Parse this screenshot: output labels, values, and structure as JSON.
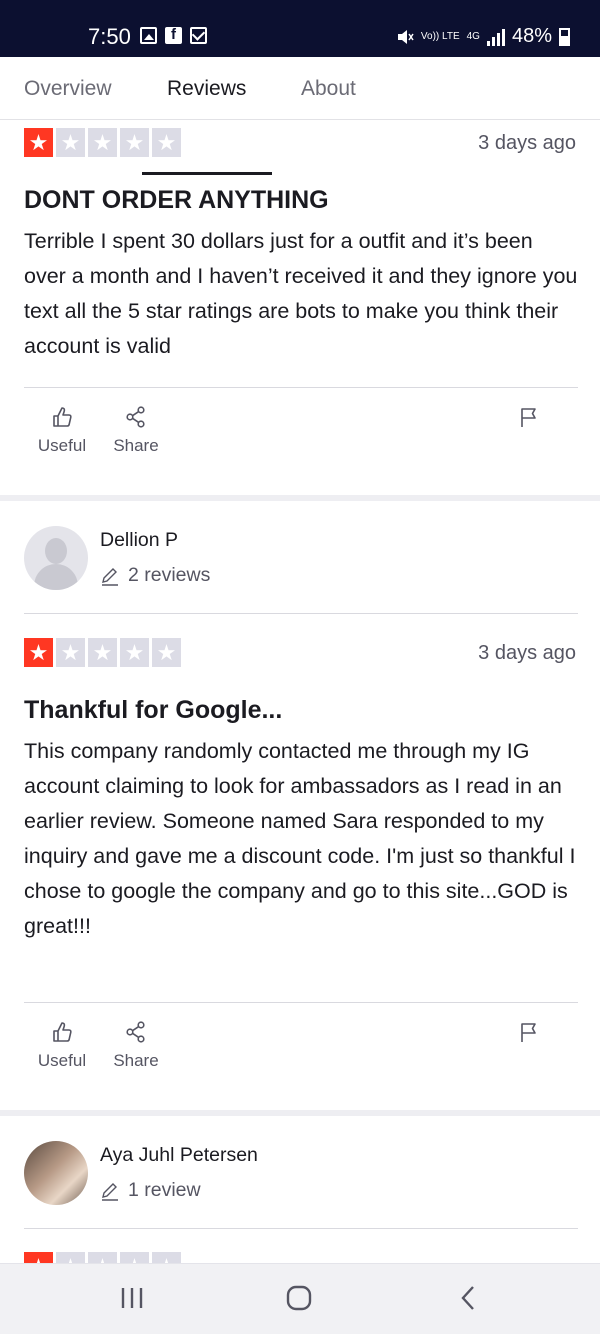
{
  "status_bar": {
    "time": "7:50",
    "network_small": "Vo)) LTE",
    "network_gen": "4G",
    "battery": "48%"
  },
  "tabs": [
    {
      "label": "Overview"
    },
    {
      "label": "Reviews"
    },
    {
      "label": "About"
    }
  ],
  "active_tab": "Reviews",
  "reviews": [
    {
      "rating": 1,
      "date": "3 days ago",
      "title": "DONT ORDER ANYTHING",
      "text": "Terrible I spent 30 dollars just for a outfit and it’s been over a month and I haven’t received it and they ignore you text all the 5 star ratings are bots to make you think their account is valid",
      "actions": {
        "useful": "Useful",
        "share": "Share"
      }
    },
    {
      "reviewer": {
        "name": "Dellion P",
        "review_count": "2 reviews"
      },
      "rating": 1,
      "date": "3 days ago",
      "title": "Thankful for Google...",
      "text": "This company randomly contacted me through my IG account claiming to look for ambassadors as I read in an earlier review. Someone named Sara responded to my inquiry and gave me a discount code. I'm just so thankful I chose to google the company and go to this site...GOD is great!!!",
      "actions": {
        "useful": "Useful",
        "share": "Share"
      }
    },
    {
      "reviewer": {
        "name": "Aya Juhl Petersen",
        "review_count": "1 review"
      },
      "rating": 1
    }
  ],
  "colors": {
    "star_active": "#ff3722",
    "star_inactive": "#dcdce6",
    "status_bar": "#0c1030"
  },
  "icons": [
    "image-icon",
    "facebook-icon",
    "mail-icon",
    "mute-icon",
    "signal-icon",
    "battery-icon",
    "thumbs-up-icon",
    "share-icon",
    "flag-icon",
    "pencil-icon",
    "recents-icon",
    "home-icon",
    "back-icon"
  ]
}
